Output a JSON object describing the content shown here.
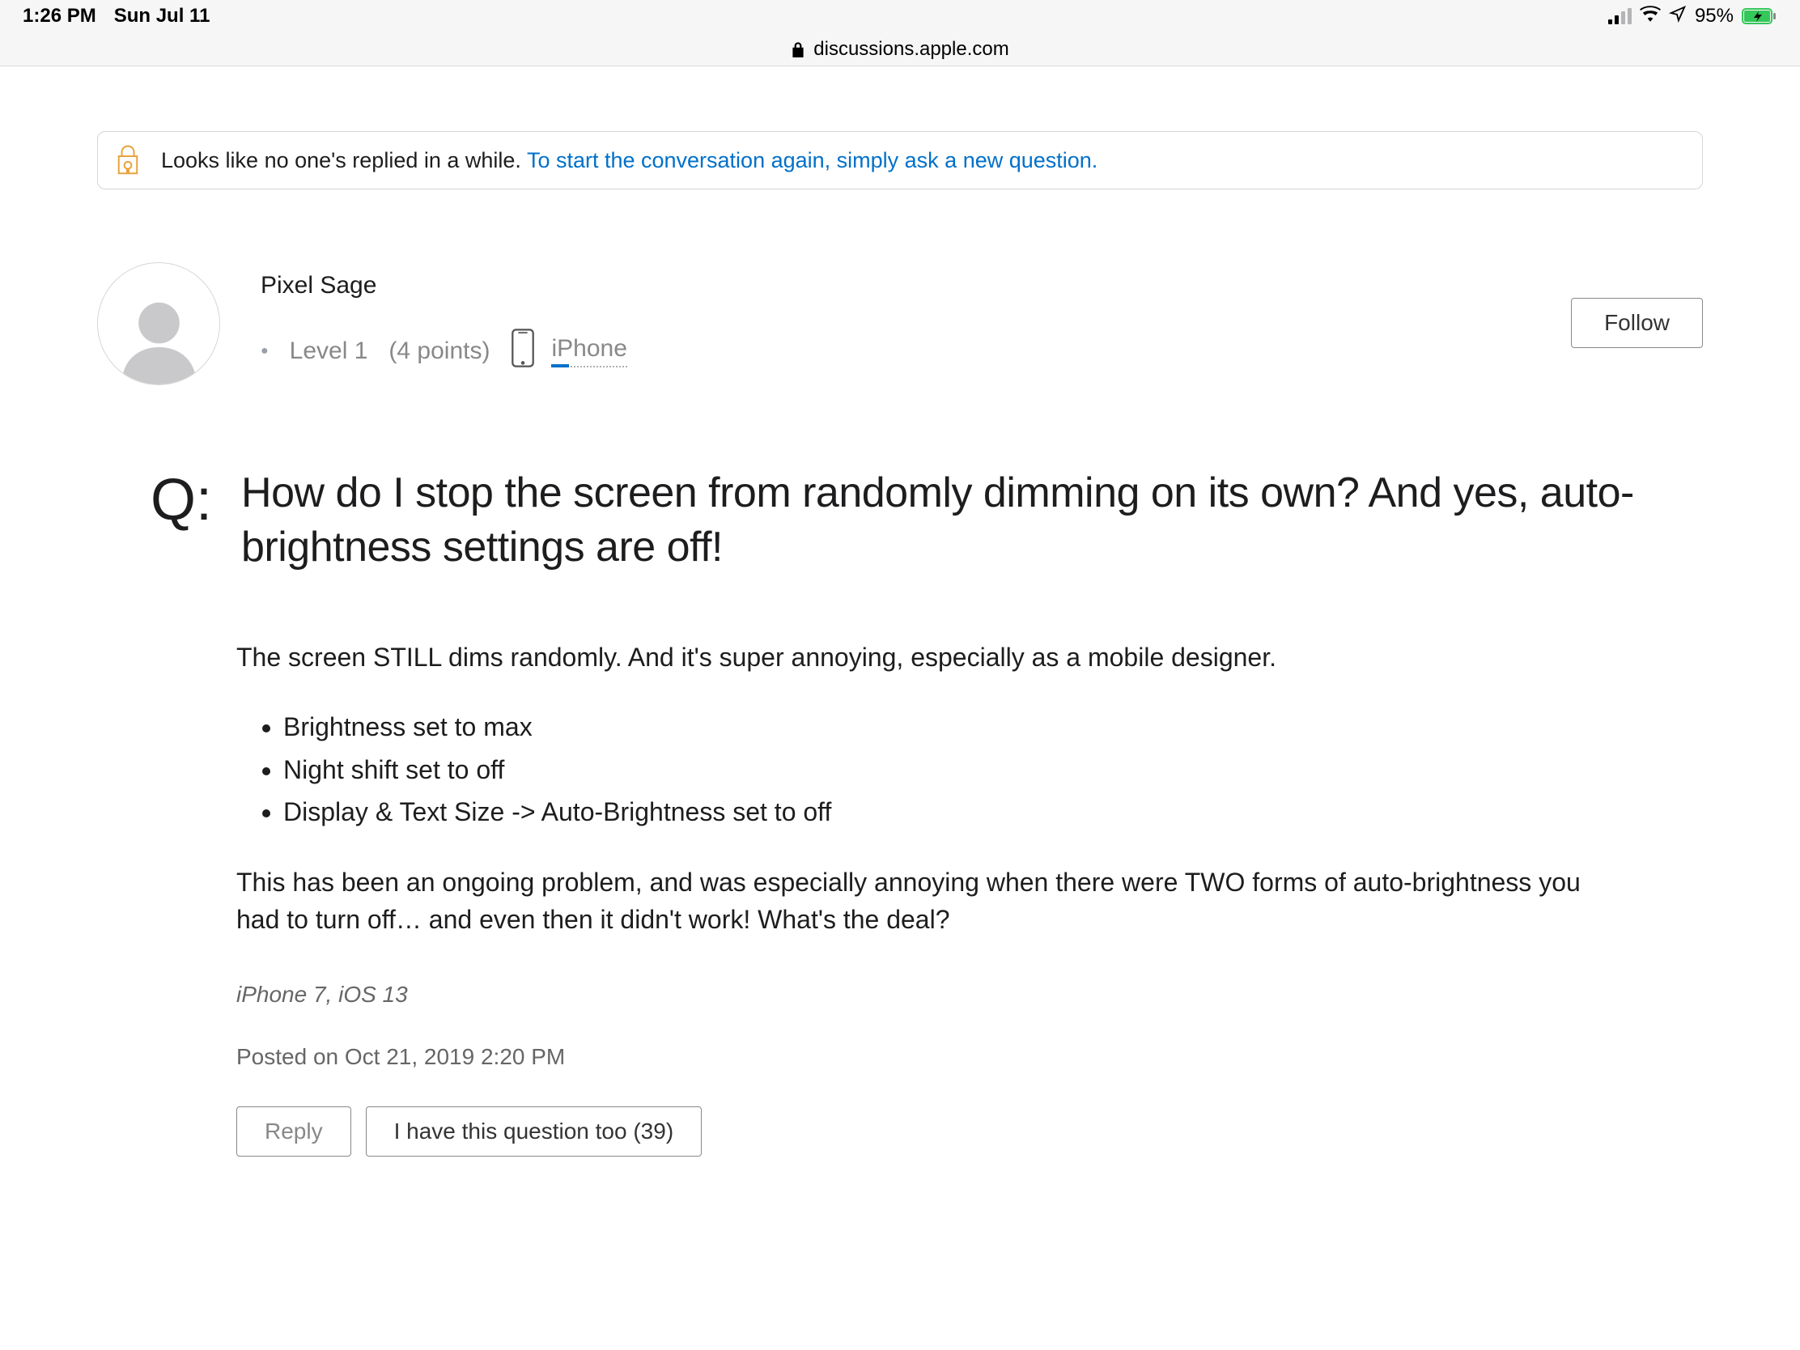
{
  "status": {
    "time": "1:26 PM",
    "date": "Sun Jul 11",
    "battery_pct": "95%"
  },
  "browser": {
    "domain": "discussions.apple.com"
  },
  "notice": {
    "text_plain": "Looks like no one's replied in a while. ",
    "link_text": "To start the conversation again, simply ask a new question."
  },
  "author": {
    "username": "Pixel Sage",
    "level": "Level 1",
    "points": "(4 points)",
    "device": "iPhone"
  },
  "actions": {
    "follow": "Follow",
    "reply": "Reply",
    "me_too": "I have this question too (39)"
  },
  "question": {
    "marker": "Q:",
    "title": "How do I stop the screen from randomly dimming on its own? And yes, auto-brightness settings are off!",
    "intro": "The screen STILL dims randomly. And it's super annoying, especially as a mobile designer.",
    "bullets": [
      "Brightness set to max",
      "Night shift set to off",
      "Display & Text Size -> Auto-Brightness set to off"
    ],
    "outro": "This has been an ongoing problem, and was especially annoying when there were TWO forms of auto-brightness you had to turn off… and even then it didn't work! What's the deal?",
    "device_meta": "iPhone 7, iOS 13",
    "posted": "Posted on Oct 21, 2019 2:20 PM"
  }
}
